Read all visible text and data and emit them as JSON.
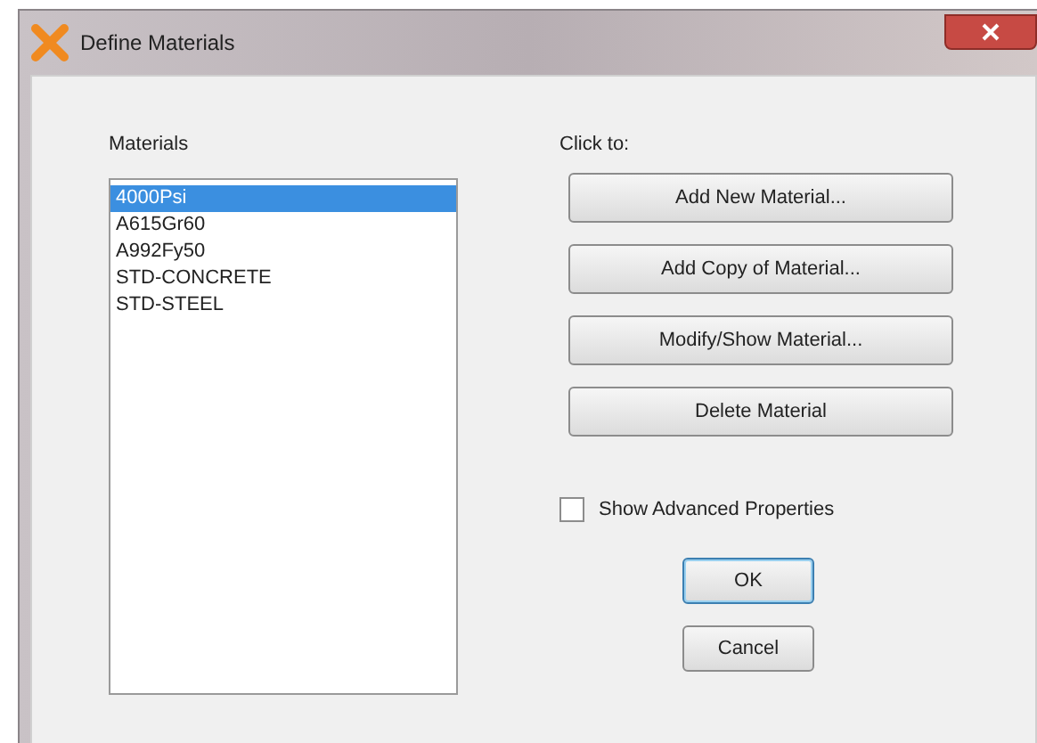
{
  "window": {
    "title": "Define Materials"
  },
  "materials": {
    "label": "Materials",
    "items": [
      {
        "name": "4000Psi",
        "selected": true
      },
      {
        "name": "A615Gr60",
        "selected": false
      },
      {
        "name": "A992Fy50",
        "selected": false
      },
      {
        "name": "STD-CONCRETE",
        "selected": false
      },
      {
        "name": "STD-STEEL",
        "selected": false
      }
    ]
  },
  "actions": {
    "label": "Click to:",
    "buttons": [
      "Add New Material...",
      "Add Copy of Material...",
      "Modify/Show Material...",
      "Delete Material"
    ]
  },
  "show_advanced": {
    "label": "Show Advanced Properties",
    "checked": false
  },
  "buttons": [
    "OK",
    "Cancel"
  ]
}
